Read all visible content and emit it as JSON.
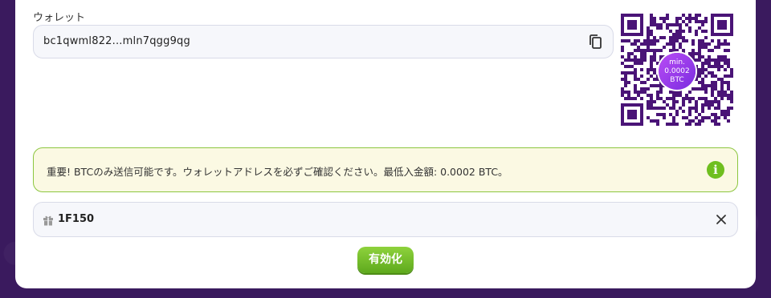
{
  "wallet": {
    "label": "ウォレット",
    "address": "bc1qwml822...mln7qgg9qg",
    "copy_icon": "copy-icon"
  },
  "qr": {
    "badge_line1": "min.",
    "badge_line2": "0.0002",
    "badge_line3": "BTC",
    "color": "#4a1477"
  },
  "notice": {
    "text": "重要! BTCのみ送信可能です。ウォレットアドレスを必ずご確認ください。最低入金額: 0.0002 BTC。",
    "icon": "info-icon",
    "icon_glyph": "i",
    "border_color": "#8cc63f",
    "background": "#fbf9e3"
  },
  "promo": {
    "icon": "gift-icon",
    "code": "1F150",
    "clear_icon": "close-icon"
  },
  "activate": {
    "label": "有効化",
    "color": "#6fbf1f"
  }
}
